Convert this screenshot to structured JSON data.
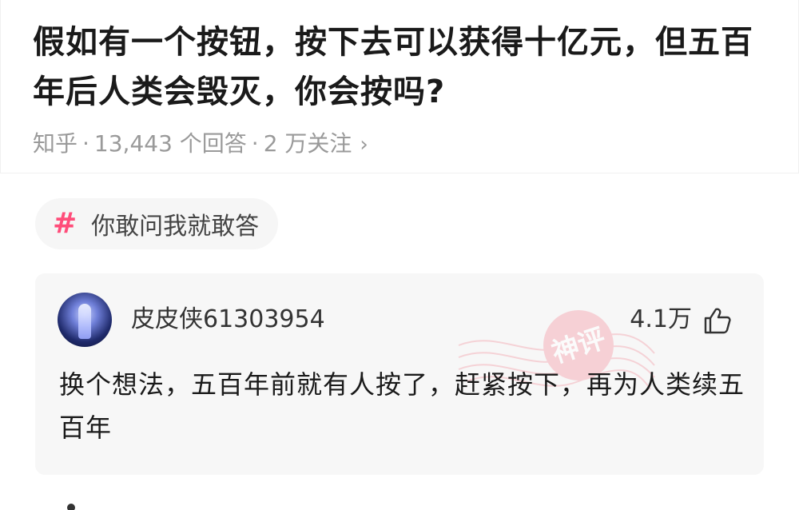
{
  "question": {
    "title": "假如有一个按钮，按下去可以获得十亿元，但五百年后人类会毁灭，你会按吗?",
    "source": "知乎",
    "answers": "13,443 个回答",
    "followers": "2 万关注",
    "chevron": "›"
  },
  "topic": {
    "icon": "hash-icon",
    "label": "你敢问我就敢答"
  },
  "answer": {
    "author": "皮皮侠61303954",
    "likes": "4.1万",
    "like_icon": "thumbs-up-icon",
    "stamp_text": "神评",
    "text": "换个想法，五百年前就有人按了，赶紧按下，再为人类续五百年"
  },
  "colors": {
    "accent": "#ff4d7a",
    "stamp": "#f2a3ad"
  }
}
